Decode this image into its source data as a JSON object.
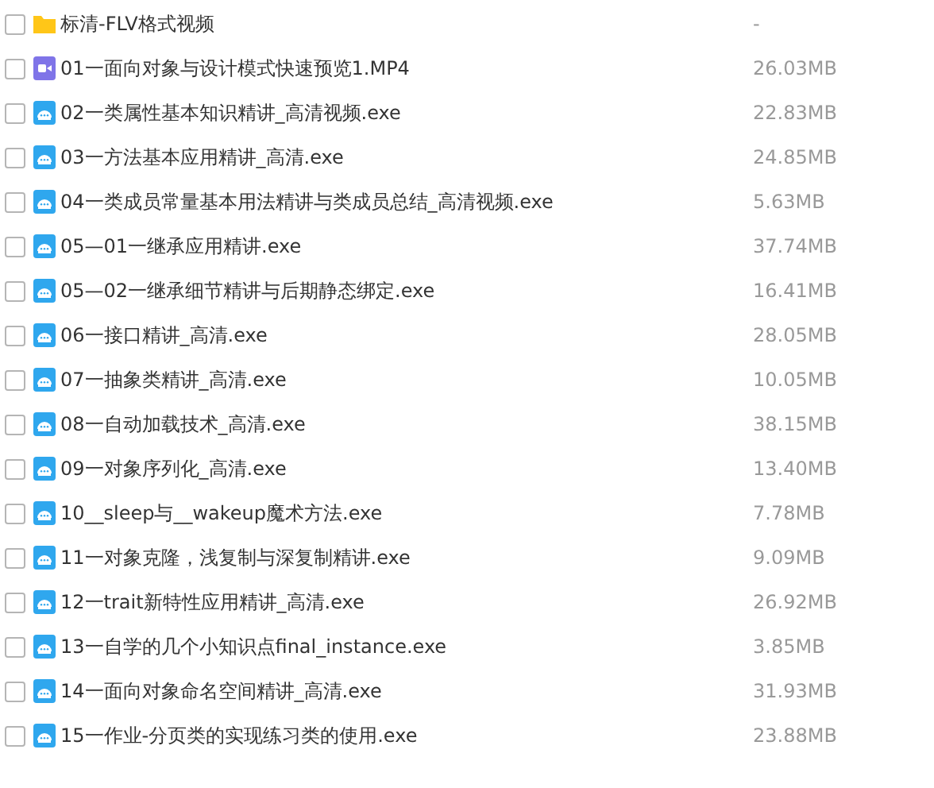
{
  "files": [
    {
      "kind": "folder",
      "checked": false,
      "name": "标清-FLV格式视频",
      "size": "-"
    },
    {
      "kind": "video",
      "checked": false,
      "name": "01一面向对象与设计模式快速预览1.MP4",
      "size": "26.03MB"
    },
    {
      "kind": "exe",
      "checked": false,
      "name": "02一类属性基本知识精讲_高清视频.exe",
      "size": "22.83MB"
    },
    {
      "kind": "exe",
      "checked": false,
      "name": "03一方法基本应用精讲_高清.exe",
      "size": "24.85MB"
    },
    {
      "kind": "exe",
      "checked": false,
      "name": "04一类成员常量基本用法精讲与类成员总结_高清视频.exe",
      "size": "5.63MB"
    },
    {
      "kind": "exe",
      "checked": false,
      "name": "05—01一继承应用精讲.exe",
      "size": "37.74MB"
    },
    {
      "kind": "exe",
      "checked": false,
      "name": "05—02一继承细节精讲与后期静态绑定.exe",
      "size": "16.41MB"
    },
    {
      "kind": "exe",
      "checked": false,
      "name": "06一接口精讲_高清.exe",
      "size": "28.05MB"
    },
    {
      "kind": "exe",
      "checked": false,
      "name": "07一抽象类精讲_高清.exe",
      "size": "10.05MB"
    },
    {
      "kind": "exe",
      "checked": false,
      "name": "08一自动加载技术_高清.exe",
      "size": "38.15MB"
    },
    {
      "kind": "exe",
      "checked": false,
      "name": "09一对象序列化_高清.exe",
      "size": "13.40MB"
    },
    {
      "kind": "exe",
      "checked": false,
      "name": "10__sleep与__wakeup魔术方法.exe",
      "size": "7.78MB"
    },
    {
      "kind": "exe",
      "checked": false,
      "name": "11一对象克隆，浅复制与深复制精讲.exe",
      "size": "9.09MB"
    },
    {
      "kind": "exe",
      "checked": false,
      "name": "12一trait新特性应用精讲_高清.exe",
      "size": "26.92MB"
    },
    {
      "kind": "exe",
      "checked": false,
      "name": "13一自学的几个小知识点final_instance.exe",
      "size": "3.85MB"
    },
    {
      "kind": "exe",
      "checked": false,
      "name": "14一面向对象命名空间精讲_高清.exe",
      "size": "31.93MB"
    },
    {
      "kind": "exe",
      "checked": false,
      "name": "15一作业-分页类的实现练习类的使用.exe",
      "size": "23.88MB"
    }
  ]
}
